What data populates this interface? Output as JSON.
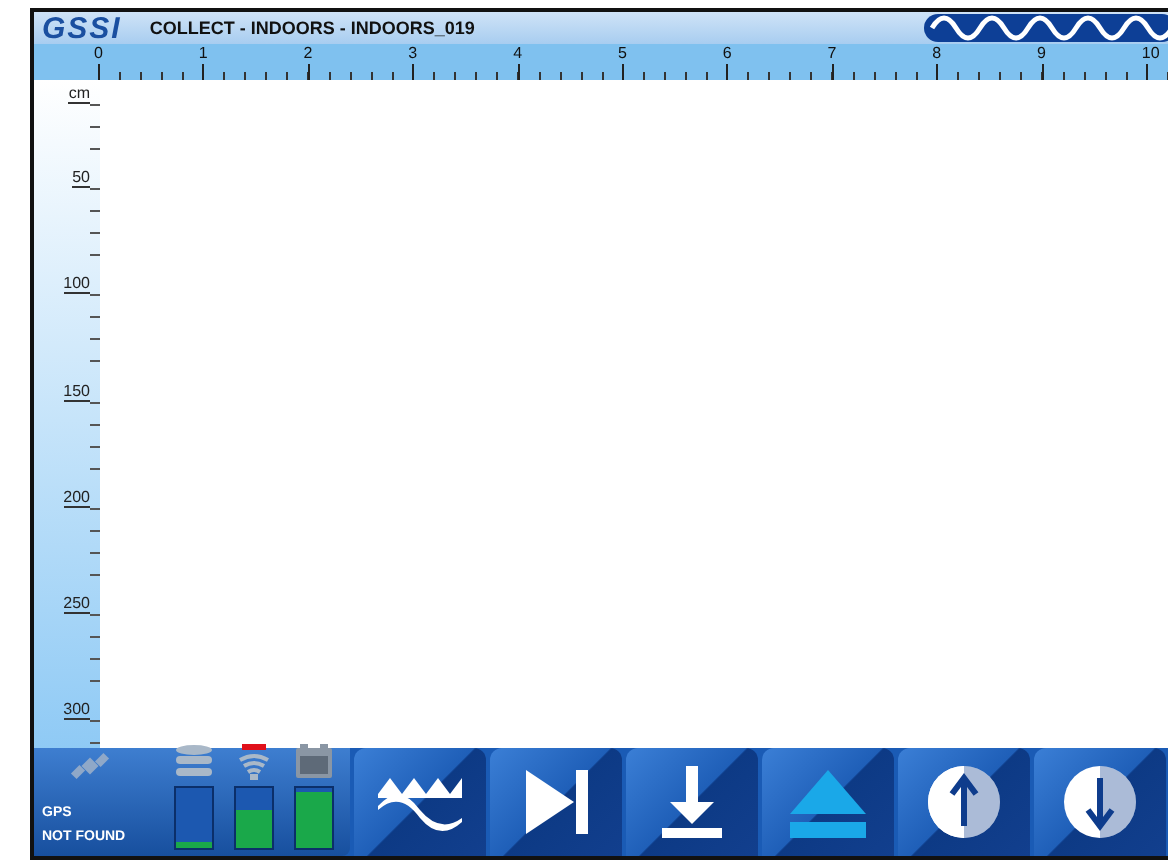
{
  "header": {
    "logo": "GSSI",
    "title": "COLLECT - INDOORS - INDOORS_019"
  },
  "top_ruler": {
    "labels": [
      "0",
      "1",
      "2",
      "3",
      "4",
      "5",
      "6",
      "7",
      "8",
      "9",
      "10"
    ]
  },
  "left_ruler": {
    "unit": "cm",
    "labels": [
      "50",
      "100",
      "150",
      "200",
      "250",
      "300"
    ]
  },
  "status": {
    "gps_label": "GPS",
    "gps_state": "NOT FOUND"
  },
  "gauges": [
    {
      "kind": "storage",
      "level": 0.1
    },
    {
      "kind": "antenna",
      "level": 0.62
    },
    {
      "kind": "battery",
      "level": 0.95
    }
  ],
  "toolbar": [
    {
      "kind": "wave"
    },
    {
      "kind": "skip"
    },
    {
      "kind": "download"
    },
    {
      "kind": "eject"
    },
    {
      "kind": "up"
    },
    {
      "kind": "down"
    }
  ]
}
